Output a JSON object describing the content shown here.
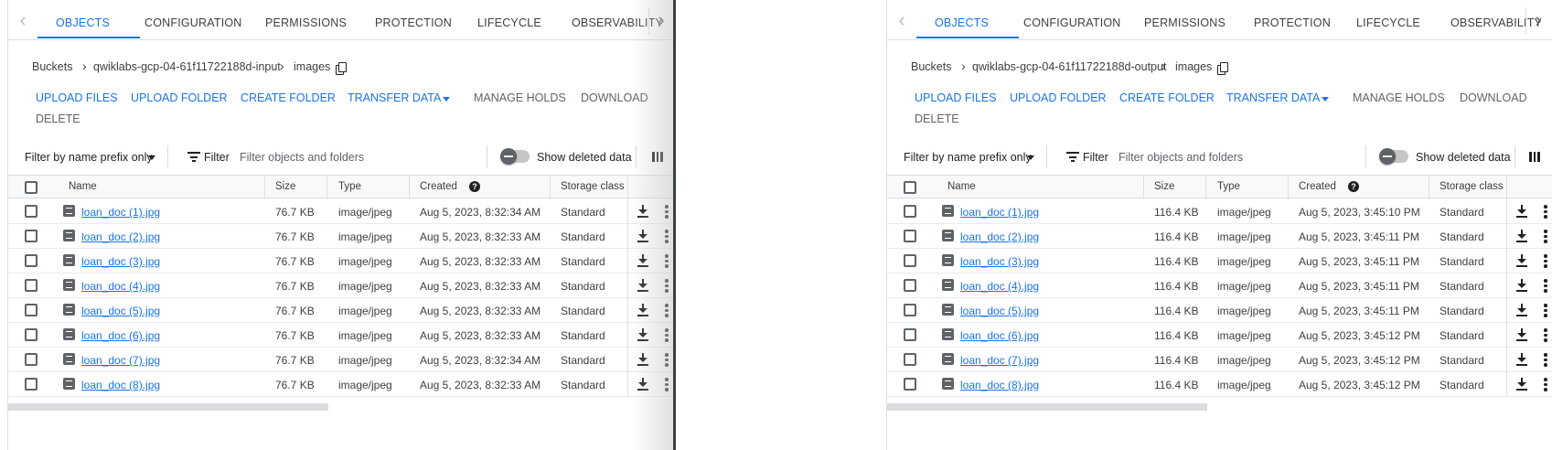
{
  "tabs": {
    "items": [
      "OBJECTS",
      "CONFIGURATION",
      "PERMISSIONS",
      "PROTECTION",
      "LIFECYCLE",
      "OBSERVABILITY"
    ],
    "active": "OBJECTS"
  },
  "icons": {
    "tab_prev": "chevron-left-icon",
    "tab_next": "chevron-right-icon",
    "copy": "copy-icon",
    "filter": "filter-list-icon",
    "columns": "column-display-icon",
    "help": "help-icon",
    "file": "image-file-icon",
    "download": "download-icon",
    "more": "more-vert-icon"
  },
  "actions": {
    "upload_files": "UPLOAD FILES",
    "upload_folder": "UPLOAD FOLDER",
    "create_folder": "CREATE FOLDER",
    "transfer_data": "TRANSFER DATA",
    "manage_holds": "MANAGE HOLDS",
    "download": "DOWNLOAD",
    "delete": "DELETE"
  },
  "filterbar": {
    "prefix_select": "Filter by name prefix only",
    "filter_label": "Filter",
    "filter_placeholder": "Filter objects and folders",
    "show_deleted": "Show deleted data"
  },
  "columns": {
    "name": "Name",
    "size": "Size",
    "type": "Type",
    "created": "Created",
    "storage_class": "Storage class"
  },
  "colors": {
    "accent": "#1a73e8",
    "text": "#3c4043",
    "disabled": "#5f6368",
    "divider": "#dadce0"
  },
  "left_panel": {
    "breadcrumb": {
      "root": "Buckets",
      "bucket": "qwiklabs-gcp-04-61f11722188d-input",
      "folder": "images"
    },
    "rows": [
      {
        "name": "loan_doc (1).jpg",
        "size": "76.7 KB",
        "type": "image/jpeg",
        "created": "Aug 5, 2023, 8:32:34 AM",
        "storage": "Standard"
      },
      {
        "name": "loan_doc (2).jpg",
        "size": "76.7 KB",
        "type": "image/jpeg",
        "created": "Aug 5, 2023, 8:32:33 AM",
        "storage": "Standard"
      },
      {
        "name": "loan_doc (3).jpg",
        "size": "76.7 KB",
        "type": "image/jpeg",
        "created": "Aug 5, 2023, 8:32:33 AM",
        "storage": "Standard"
      },
      {
        "name": "loan_doc (4).jpg",
        "size": "76.7 KB",
        "type": "image/jpeg",
        "created": "Aug 5, 2023, 8:32:33 AM",
        "storage": "Standard"
      },
      {
        "name": "loan_doc (5).jpg",
        "size": "76.7 KB",
        "type": "image/jpeg",
        "created": "Aug 5, 2023, 8:32:33 AM",
        "storage": "Standard"
      },
      {
        "name": "loan_doc (6).jpg",
        "size": "76.7 KB",
        "type": "image/jpeg",
        "created": "Aug 5, 2023, 8:32:33 AM",
        "storage": "Standard"
      },
      {
        "name": "loan_doc (7).jpg",
        "size": "76.7 KB",
        "type": "image/jpeg",
        "created": "Aug 5, 2023, 8:32:34 AM",
        "storage": "Standard"
      },
      {
        "name": "loan_doc (8).jpg",
        "size": "76.7 KB",
        "type": "image/jpeg",
        "created": "Aug 5, 2023, 8:32:33 AM",
        "storage": "Standard"
      }
    ]
  },
  "right_panel": {
    "breadcrumb": {
      "root": "Buckets",
      "bucket": "qwiklabs-gcp-04-61f11722188d-output",
      "folder": "images"
    },
    "rows": [
      {
        "name": "loan_doc (1).jpg",
        "size": "116.4 KB",
        "type": "image/jpeg",
        "created": "Aug 5, 2023, 3:45:10 PM",
        "storage": "Standard"
      },
      {
        "name": "loan_doc (2).jpg",
        "size": "116.4 KB",
        "type": "image/jpeg",
        "created": "Aug 5, 2023, 3:45:11 PM",
        "storage": "Standard"
      },
      {
        "name": "loan_doc (3).jpg",
        "size": "116.4 KB",
        "type": "image/jpeg",
        "created": "Aug 5, 2023, 3:45:11 PM",
        "storage": "Standard"
      },
      {
        "name": "loan_doc (4).jpg",
        "size": "116.4 KB",
        "type": "image/jpeg",
        "created": "Aug 5, 2023, 3:45:11 PM",
        "storage": "Standard"
      },
      {
        "name": "loan_doc (5).jpg",
        "size": "116.4 KB",
        "type": "image/jpeg",
        "created": "Aug 5, 2023, 3:45:11 PM",
        "storage": "Standard"
      },
      {
        "name": "loan_doc (6).jpg",
        "size": "116.4 KB",
        "type": "image/jpeg",
        "created": "Aug 5, 2023, 3:45:12 PM",
        "storage": "Standard"
      },
      {
        "name": "loan_doc (7).jpg",
        "size": "116.4 KB",
        "type": "image/jpeg",
        "created": "Aug 5, 2023, 3:45:12 PM",
        "storage": "Standard"
      },
      {
        "name": "loan_doc (8).jpg",
        "size": "116.4 KB",
        "type": "image/jpeg",
        "created": "Aug 5, 2023, 3:45:12 PM",
        "storage": "Standard"
      }
    ]
  }
}
